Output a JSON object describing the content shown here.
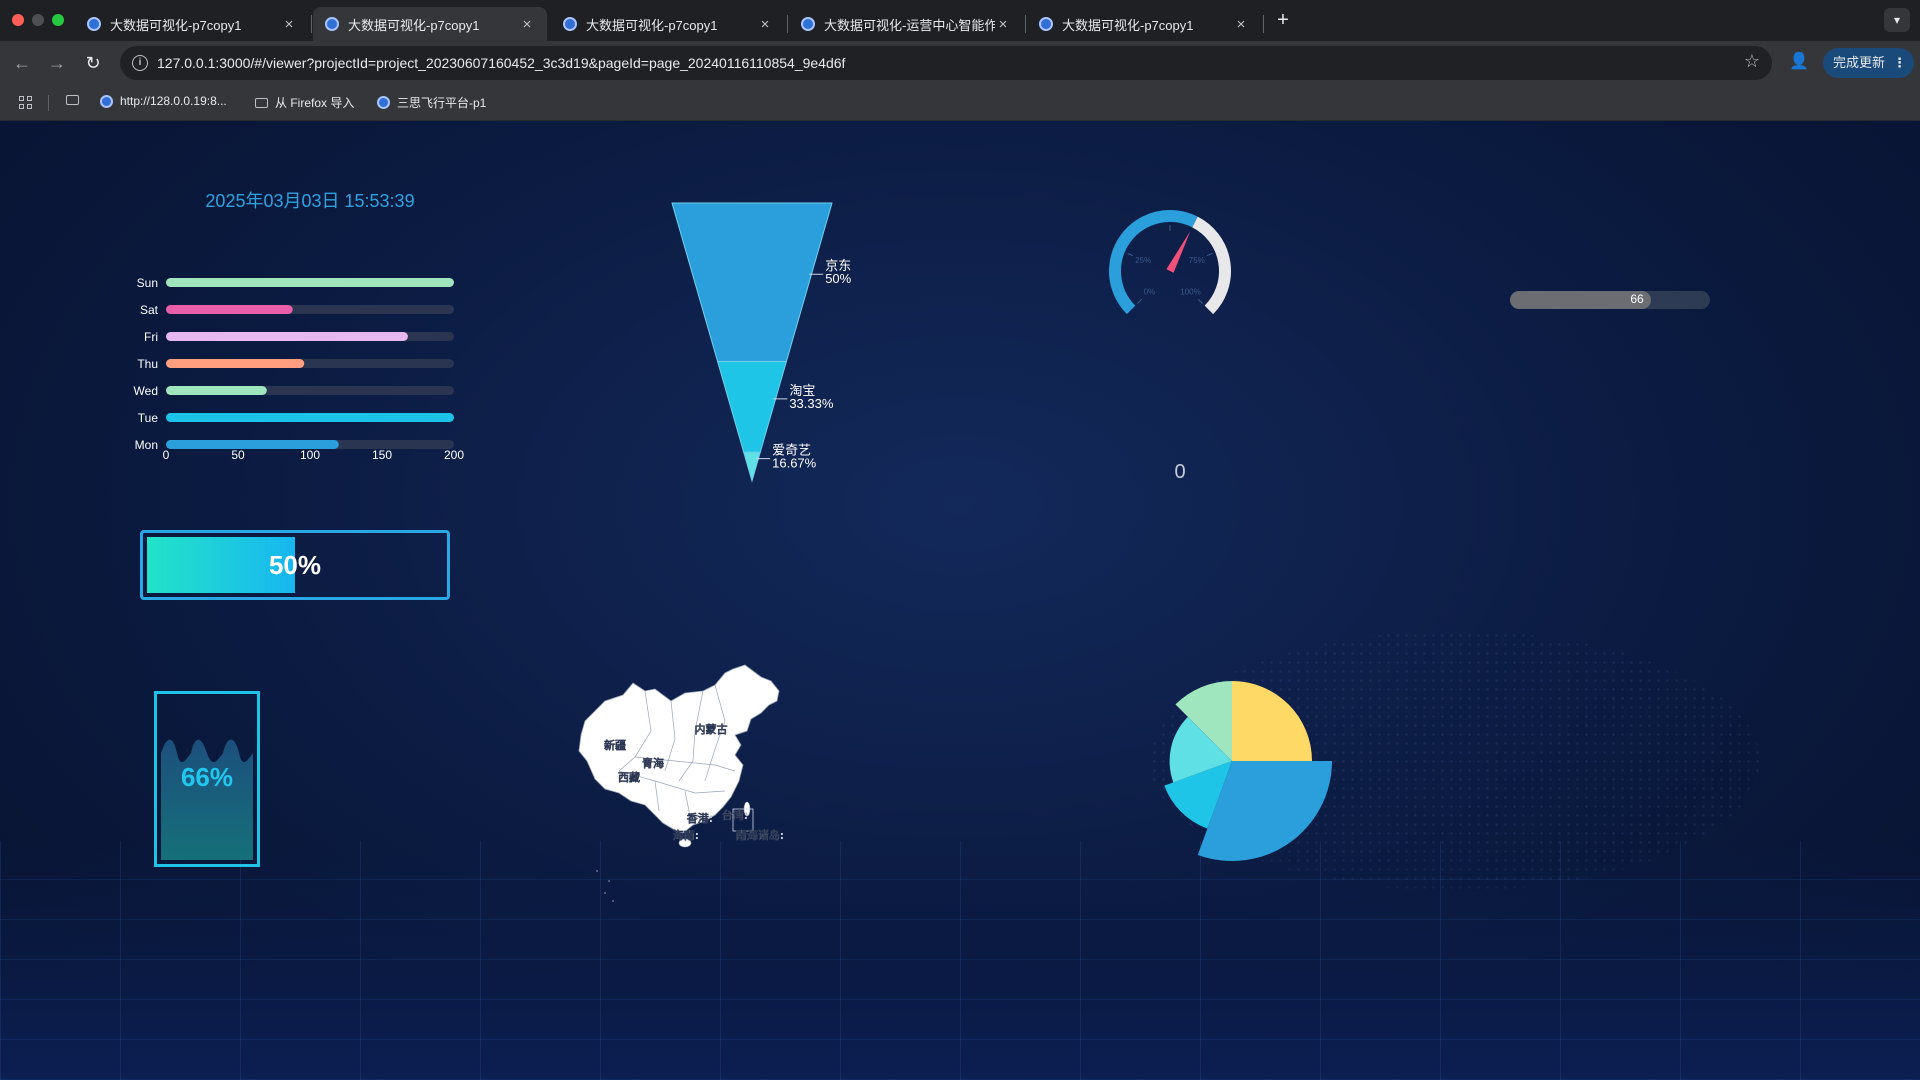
{
  "browser": {
    "tabs": [
      {
        "title": "大数据可视化-p7copy1",
        "active": false
      },
      {
        "title": "大数据可视化-p7copy1",
        "active": true
      },
      {
        "title": "大数据可视化-p7copy1",
        "active": false
      },
      {
        "title": "大数据可视化-运营中心智能作业",
        "active": false
      },
      {
        "title": "大数据可视化-p7copy1",
        "active": false
      }
    ],
    "close_glyph": "×",
    "new_tab_glyph": "+",
    "url": "127.0.0.1:3000/#/viewer?projectId=project_20230607160452_3c3d19&pageId=page_20240116110854_9e4d6f",
    "update_button": "完成更新",
    "bookmarks": [
      {
        "label": "http://128.0.0.19:8...",
        "icon": "globe-icon"
      },
      {
        "label": "从 Firefox 导入",
        "icon": "folder-icon"
      },
      {
        "label": "三思飞行平台-p1",
        "icon": "globe-icon"
      }
    ]
  },
  "dashboard": {
    "datetime": "2025年03月03日 15:53:39",
    "progress": {
      "value": 0.5,
      "label": "50%"
    },
    "water": {
      "value": 0.66,
      "label": "66%"
    },
    "gauge": {
      "value": 0.6,
      "ticks": [
        "0%",
        "25%",
        "75%",
        "100%"
      ],
      "below_value": "0"
    },
    "slider": {
      "value": 66,
      "max": 100,
      "label": "66"
    },
    "map": {
      "labels": [
        "内蒙古",
        "新疆",
        "青海",
        "西藏",
        "台湾:",
        "香港:",
        "海南:",
        "南海诸岛:"
      ],
      "colors": {
        "fill": "#ffffff",
        "stroke": "#9aa4b8"
      }
    }
  },
  "chart_data": [
    {
      "type": "bar",
      "orientation": "horizontal",
      "categories": [
        "Mon",
        "Tue",
        "Wed",
        "Thu",
        "Fri",
        "Sat",
        "Sun"
      ],
      "values": [
        120,
        200,
        70,
        96,
        168,
        88,
        200
      ],
      "xlim": [
        0,
        200
      ],
      "xticks": [
        "0",
        "50",
        "100",
        "150",
        "200"
      ],
      "colors": [
        "#2a9fdc",
        "#1bc3e6",
        "#9fe5bd",
        "#ff9f7f",
        "#e7b8f0",
        "#e95ea8",
        "#9fe5bd"
      ],
      "track_color": "#2a3552"
    },
    {
      "type": "funnel",
      "categories": [
        "京东",
        "淘宝",
        "爱奇艺"
      ],
      "values": [
        50,
        33.33,
        16.67
      ],
      "labels": [
        "50%",
        "33.33%",
        "16.67%"
      ],
      "colors": [
        "#2b9fdb",
        "#1ec5e6",
        "#5fe0e4"
      ]
    },
    {
      "type": "pie",
      "variant": "rose",
      "values": [
        1.0,
        1.25,
        0.9,
        0.78,
        1.0
      ],
      "colors": [
        "#ffd966",
        "#2b9fdb",
        "#1ec5e6",
        "#5fe0e4",
        "#9fe5bd"
      ]
    }
  ]
}
